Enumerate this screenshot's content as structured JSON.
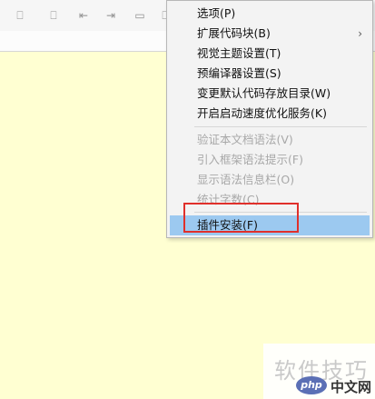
{
  "menu": {
    "items": [
      {
        "label": "选项(P)",
        "enabled": true
      },
      {
        "label": "扩展代码块(B)",
        "enabled": true,
        "submenu_arrow": "›"
      },
      {
        "label": "视觉主题设置(T)",
        "enabled": true
      },
      {
        "label": "预编译器设置(S)",
        "enabled": true
      },
      {
        "label": "变更默认代码存放目录(W)",
        "enabled": true
      },
      {
        "label": "开启启动速度优化服务(K)",
        "enabled": true
      },
      {
        "label": "验证本文档语法(V)",
        "enabled": false
      },
      {
        "label": "引入框架语法提示(F)",
        "enabled": false
      },
      {
        "label": "显示语法信息栏(O)",
        "enabled": false
      },
      {
        "label": "统计字数(C)",
        "enabled": false
      },
      {
        "label": "插件安装(F)",
        "enabled": true,
        "selected": true
      }
    ]
  },
  "watermark": {
    "text": "软件技巧",
    "logo": "php",
    "site": "中文网"
  },
  "colors": {
    "editor_bg": "#ffffd2",
    "selection": "#9cc9f0",
    "highlight": "#e0302b"
  }
}
